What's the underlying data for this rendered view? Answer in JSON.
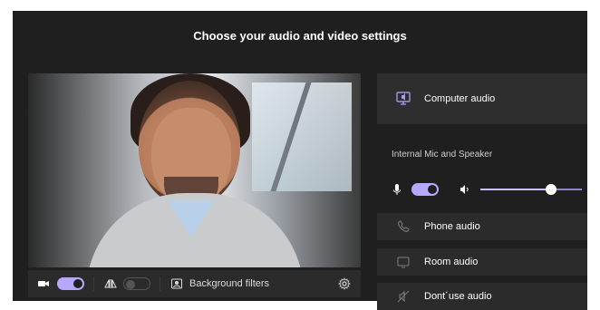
{
  "dialog": {
    "title": "Choose your audio and video settings"
  },
  "video": {
    "camera_toggle_on": true,
    "mirror_toggle_on": false,
    "background_filters_label": "Background filters"
  },
  "audio_options": {
    "computer_audio_label": "Computer audio",
    "device_label": "Internal Mic and Speaker",
    "mic_toggle_on": true,
    "speaker_volume_percent": 70,
    "phone_audio_label": "Phone audio",
    "room_audio_label": "Room audio",
    "dont_use_audio_label": "Dont´use audio"
  },
  "colors": {
    "background": "#1f1f1f",
    "tile_background": "#2b2b2b",
    "accent": "#b8a7ff",
    "text_primary": "#ffffff",
    "text_secondary": "#cfcfcf"
  },
  "icons": {
    "camera": "camera-icon",
    "mirror": "mirror-icon",
    "background_filters": "background-filters-icon",
    "settings": "gear-icon",
    "computer_audio": "computer-audio-icon",
    "microphone": "microphone-icon",
    "speaker": "speaker-icon",
    "phone_audio": "phone-icon",
    "room_audio": "room-icon",
    "dont_use_audio": "no-audio-icon"
  }
}
